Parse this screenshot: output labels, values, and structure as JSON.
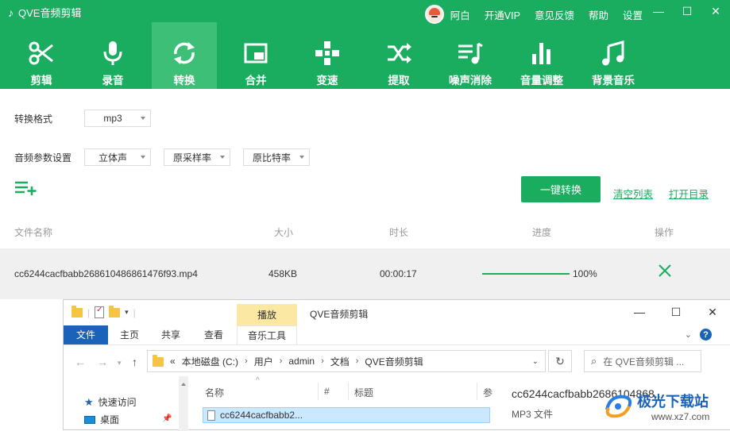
{
  "app": {
    "title": "QVE音频剪辑",
    "user_name": "阿白",
    "top_links": [
      "开通VIP",
      "意见反馈",
      "帮助",
      "设置"
    ],
    "window_controls": [
      "—",
      "☐",
      "✕"
    ]
  },
  "toolbar": {
    "tools": [
      {
        "label": "剪辑",
        "icon": "scissors-icon"
      },
      {
        "label": "录音",
        "icon": "microphone-icon"
      },
      {
        "label": "转换",
        "icon": "convert-icon",
        "active": true
      },
      {
        "label": "合并",
        "icon": "merge-icon"
      },
      {
        "label": "变速",
        "icon": "speed-icon"
      },
      {
        "label": "提取",
        "icon": "shuffle-icon"
      },
      {
        "label": "噪声消除",
        "icon": "noise-icon"
      },
      {
        "label": "音量调整",
        "icon": "volume-bars-icon"
      },
      {
        "label": "背景音乐",
        "icon": "music-note-icon"
      }
    ]
  },
  "settings": {
    "format_label": "转换格式",
    "format_value": "mp3",
    "params_label": "音频参数设置",
    "channel_value": "立体声",
    "samplerate_value": "原采样率",
    "bitrate_value": "原比特率"
  },
  "actions": {
    "convert_button": "一键转换",
    "clear_list": "清空列表",
    "open_folder": "打开目录"
  },
  "file_table": {
    "headers": [
      "文件名称",
      "大小",
      "时长",
      "进度",
      "操作"
    ],
    "rows": [
      {
        "name": "cc6244cacfbabb268610486861476f93.mp4",
        "size": "458KB",
        "duration": "00:00:17",
        "progress_text": "100%",
        "progress": 1.0
      }
    ]
  },
  "explorer": {
    "context_tab": "播放",
    "window_title": "QVE音频剪辑",
    "window_controls": [
      "—",
      "☐",
      "✕"
    ],
    "ribbon_tabs": [
      "文件",
      "主页",
      "共享",
      "查看",
      "音乐工具"
    ],
    "address": [
      "«",
      "本地磁盘 (C:)",
      "用户",
      "admin",
      "文档",
      "QVE音频剪辑"
    ],
    "search_placeholder": "在 QVE音频剪辑 ...",
    "nav_items": [
      "快速访问",
      "桌面"
    ],
    "columns": [
      "名称",
      "#",
      "标题",
      "参"
    ],
    "selected_file": "cc6244cacfbabb2...",
    "details_name": "cc6244cacfbabb2686104868...",
    "details_type": "MP3 文件"
  },
  "watermark": {
    "text": "极光下载站",
    "url": "www.xz7.com"
  },
  "colors": {
    "brand": "#1aad5f",
    "brand_active": "#3dbf77",
    "explorer_blue": "#1a63b8"
  }
}
